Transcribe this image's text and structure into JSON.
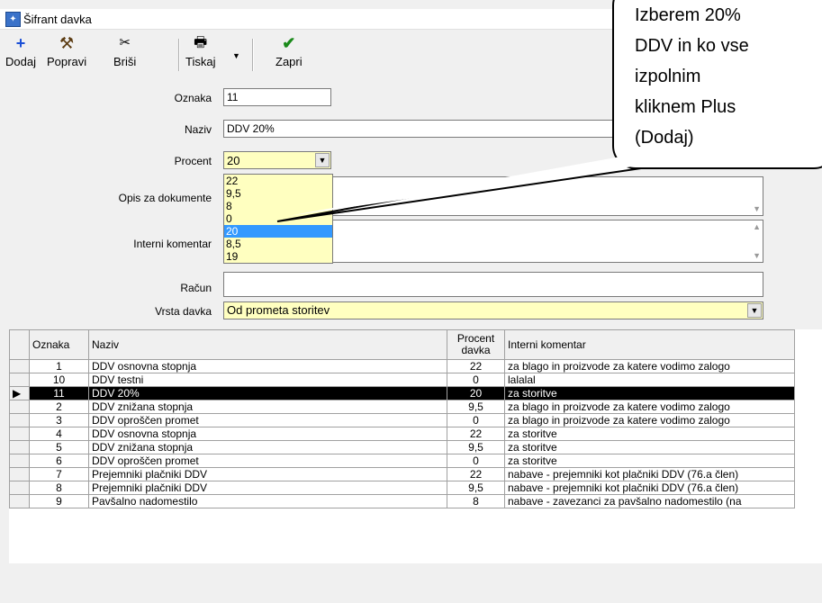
{
  "window": {
    "title": "Šifrant davka"
  },
  "toolbar": {
    "add": "Dodaj",
    "edit": "Popravi",
    "delete": "Briši",
    "print": "Tiskaj",
    "close": "Zapri"
  },
  "form": {
    "oznaka_label": "Oznaka",
    "oznaka_value": "11",
    "naziv_label": "Naziv",
    "naziv_value": "DDV 20%",
    "procent_label": "Procent",
    "procent_value": "20",
    "opis_label": "Opis za dokumente",
    "interni_label": "Interni komentar",
    "racun_label": "Račun",
    "vrsta_label": "Vrsta davka",
    "vrsta_value": "Od prometa storitev"
  },
  "dropdown": {
    "options": [
      "22",
      "9,5",
      "8",
      "0",
      "20",
      "8,5",
      "19"
    ],
    "selected": "20"
  },
  "table": {
    "headers": {
      "oznaka": "Oznaka",
      "naziv": "Naziv",
      "procent": "Procent davka",
      "komentar": "Interni komentar"
    },
    "rows": [
      {
        "oznaka": "1",
        "naziv": "DDV osnovna stopnja",
        "procent": "22",
        "komentar": "za blago in proizvode za katere vodimo zalogo"
      },
      {
        "oznaka": "10",
        "naziv": "DDV testni",
        "procent": "0",
        "komentar": "lalalal"
      },
      {
        "oznaka": "11",
        "naziv": "DDV 20%",
        "procent": "20",
        "komentar": "za storitve"
      },
      {
        "oznaka": "2",
        "naziv": "DDV znižana stopnja",
        "procent": "9,5",
        "komentar": "za blago in proizvode za katere vodimo zalogo"
      },
      {
        "oznaka": "3",
        "naziv": "DDV oproščen promet",
        "procent": "0",
        "komentar": "za blago in proizvode za katere vodimo zalogo"
      },
      {
        "oznaka": "4",
        "naziv": "DDV osnovna stopnja",
        "procent": "22",
        "komentar": "za storitve"
      },
      {
        "oznaka": "5",
        "naziv": "DDV znižana stopnja",
        "procent": "9,5",
        "komentar": "za storitve"
      },
      {
        "oznaka": "6",
        "naziv": "DDV oproščen promet",
        "procent": "0",
        "komentar": "za storitve"
      },
      {
        "oznaka": "7",
        "naziv": "Prejemniki plačniki DDV",
        "procent": "22",
        "komentar": "nabave - prejemniki kot plačniki DDV (76.a člen)"
      },
      {
        "oznaka": "8",
        "naziv": "Prejemniki plačniki DDV",
        "procent": "9,5",
        "komentar": "nabave - prejemniki kot plačniki DDV (76.a člen)"
      },
      {
        "oznaka": "9",
        "naziv": "Pavšalno nadomestilo",
        "procent": "8",
        "komentar": "nabave - zavezanci za pavšalno nadomestilo (na"
      }
    ]
  },
  "callout": {
    "lines": [
      "Izberem 20%",
      "DDV in ko vse",
      "izpolnim",
      "kliknem Plus",
      "(Dodaj)"
    ]
  }
}
